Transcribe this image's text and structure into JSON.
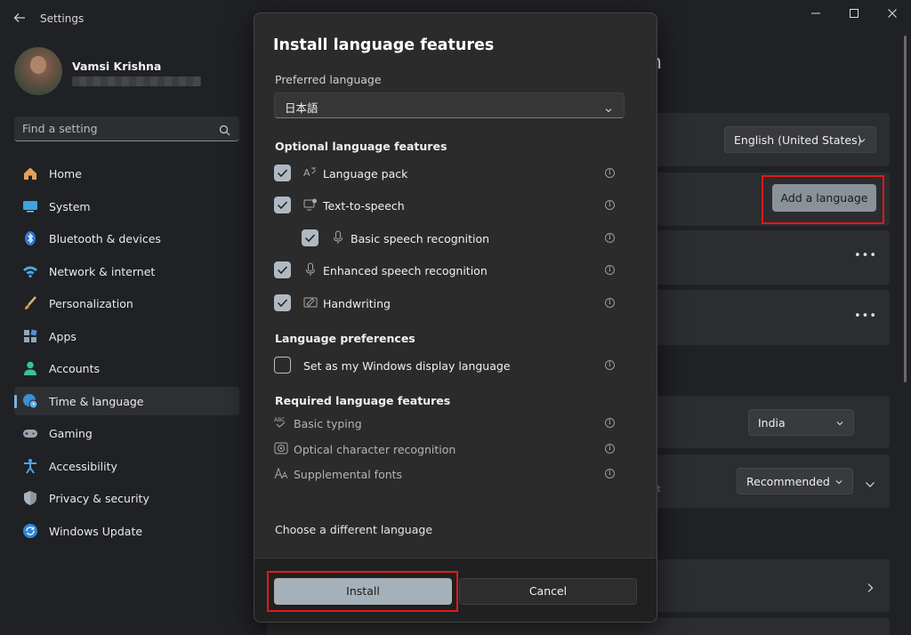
{
  "app": {
    "title": "Settings"
  },
  "profile": {
    "name": "Vamsi Krishna"
  },
  "search": {
    "placeholder": "Find a setting"
  },
  "sidebar": {
    "items": [
      {
        "label": "Home",
        "icon": "home-icon"
      },
      {
        "label": "System",
        "icon": "system-icon"
      },
      {
        "label": "Bluetooth & devices",
        "icon": "bluetooth-icon"
      },
      {
        "label": "Network & internet",
        "icon": "wifi-icon"
      },
      {
        "label": "Personalization",
        "icon": "brush-icon"
      },
      {
        "label": "Apps",
        "icon": "apps-icon"
      },
      {
        "label": "Accounts",
        "icon": "person-icon"
      },
      {
        "label": "Time & language",
        "icon": "globe-clock-icon",
        "active": true
      },
      {
        "label": "Gaming",
        "icon": "gamepad-icon"
      },
      {
        "label": "Accessibility",
        "icon": "accessibility-icon"
      },
      {
        "label": "Privacy & security",
        "icon": "shield-icon"
      },
      {
        "label": "Windows Update",
        "icon": "update-icon"
      }
    ]
  },
  "background": {
    "title_fragment": "n",
    "display_language": "English (United States)",
    "add_language_label": "Add a language",
    "region_value": "India",
    "format_value": "Recommended",
    "format_fragment": "it"
  },
  "dialog": {
    "title": "Install language features",
    "preferred_language_label": "Preferred language",
    "preferred_language_value": "日本語",
    "optional_heading": "Optional language features",
    "optional_features": [
      {
        "label": "Language pack",
        "checked": true,
        "icon": "language-pack-icon"
      },
      {
        "label": "Text-to-speech",
        "checked": true,
        "icon": "text-to-speech-icon"
      },
      {
        "label": "Basic speech recognition",
        "checked": true,
        "icon": "microphone-icon",
        "indented": true
      },
      {
        "label": "Enhanced speech recognition",
        "checked": true,
        "icon": "microphone-icon"
      },
      {
        "label": "Handwriting",
        "checked": true,
        "icon": "handwriting-icon"
      }
    ],
    "preferences_heading": "Language preferences",
    "display_language_option": {
      "label": "Set as my Windows display language",
      "checked": false
    },
    "required_heading": "Required language features",
    "required_features": [
      {
        "label": "Basic typing",
        "icon": "spellcheck-icon"
      },
      {
        "label": "Optical character recognition",
        "icon": "ocr-icon"
      },
      {
        "label": "Supplemental fonts",
        "icon": "font-icon"
      }
    ],
    "choose_link": "Choose a different language",
    "install_label": "Install",
    "cancel_label": "Cancel"
  },
  "colors": {
    "accent": "#7fb4e0",
    "highlight": "#e0191b",
    "checkbox_fill": "#aeb9c3"
  }
}
